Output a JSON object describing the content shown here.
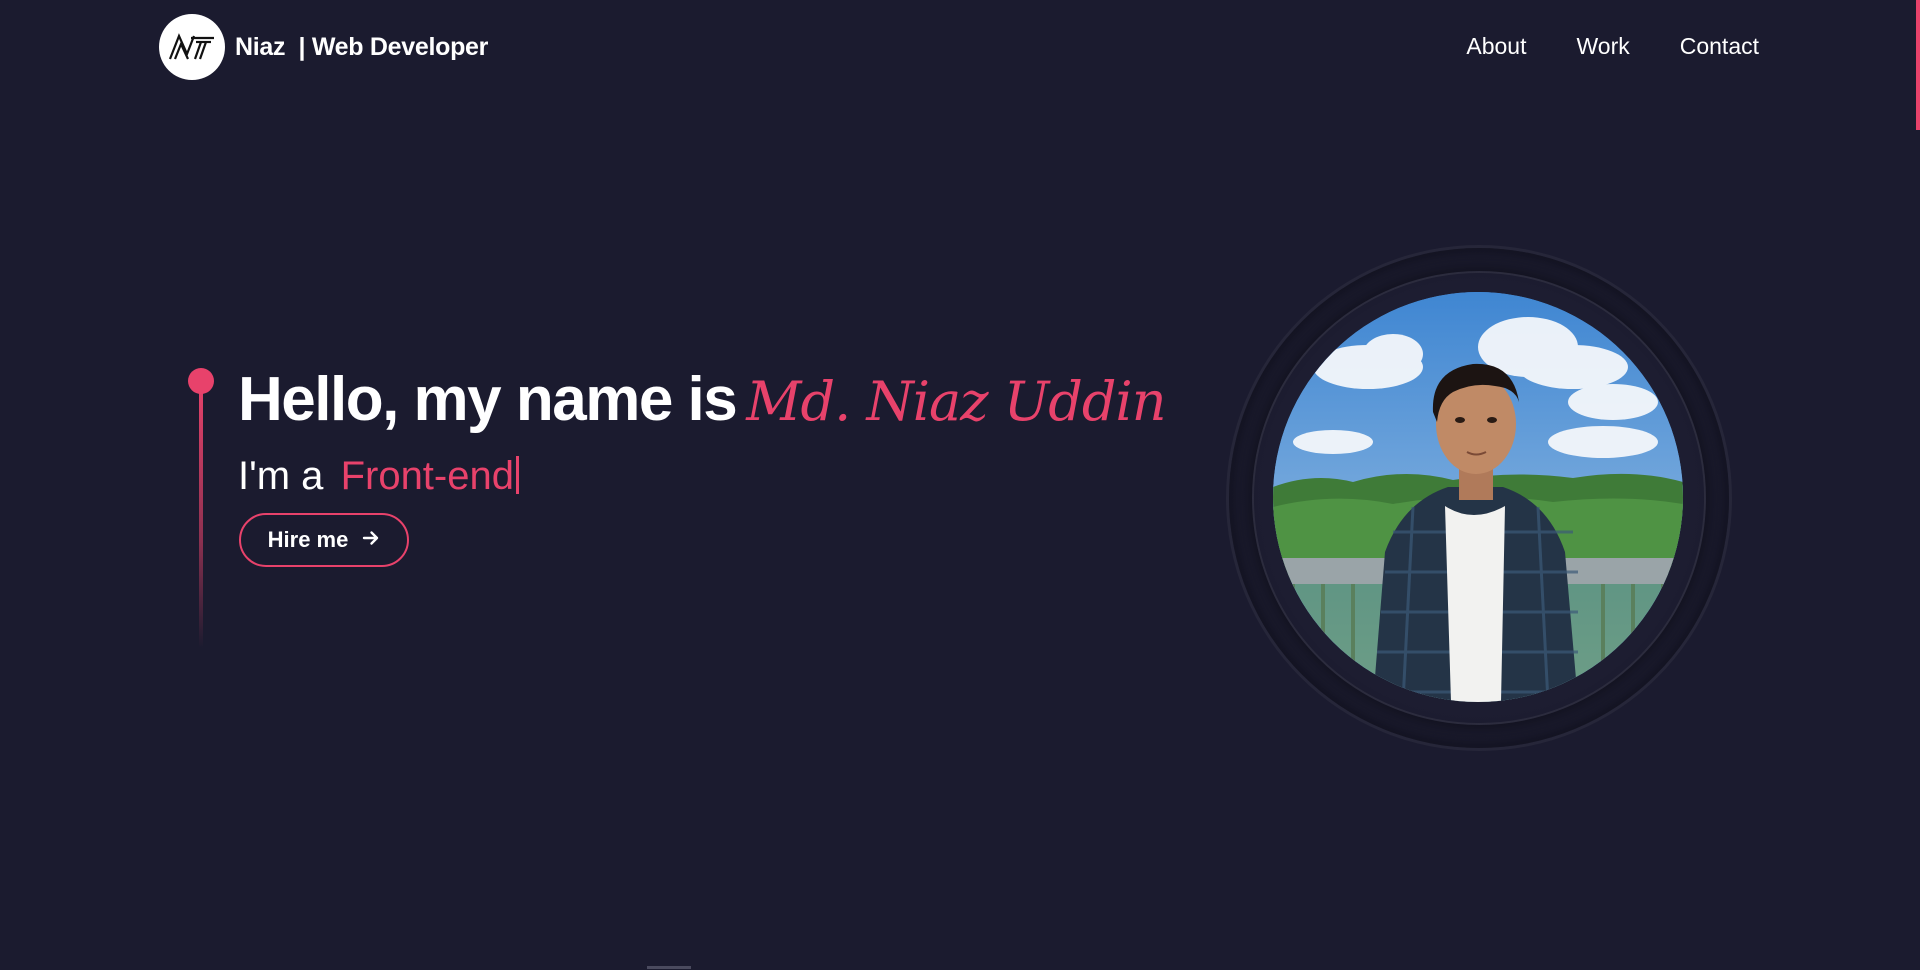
{
  "header": {
    "brand_text": "Niaz  | Web Developer",
    "logo_icon": "nt-monogram-logo",
    "nav": [
      {
        "label": "About"
      },
      {
        "label": "Work"
      },
      {
        "label": "Contact"
      }
    ]
  },
  "hero": {
    "greeting": "Hello, my name is",
    "name": "Md. Niaz Uddin",
    "intro_prefix": "I'm a",
    "role": "Front-end",
    "hire_button": {
      "label": "Hire me",
      "icon": "arrow-right-icon"
    },
    "portrait_icon": "profile-photo"
  },
  "colors": {
    "background": "#1b1b2f",
    "accent": "#e8426b",
    "text": "#ffffff"
  }
}
